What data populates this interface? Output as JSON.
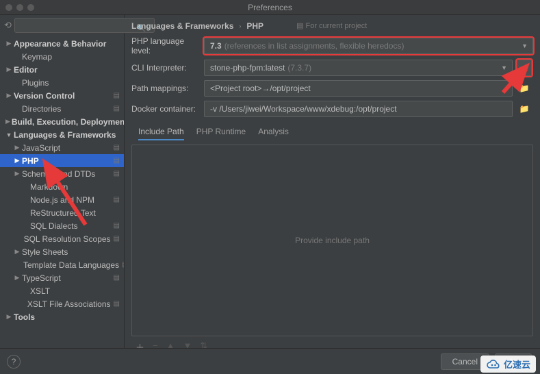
{
  "window": {
    "title": "Preferences"
  },
  "sidebar": {
    "search_placeholder": "",
    "items": [
      {
        "label": "Appearance & Behavior",
        "arrow": "▶",
        "ind": 1,
        "bold": true
      },
      {
        "label": "Keymap",
        "arrow": "",
        "ind": 2
      },
      {
        "label": "Editor",
        "arrow": "▶",
        "ind": 1,
        "bold": true
      },
      {
        "label": "Plugins",
        "arrow": "",
        "ind": 2
      },
      {
        "label": "Version Control",
        "arrow": "▶",
        "ind": 1,
        "bold": true,
        "proj": true
      },
      {
        "label": "Directories",
        "arrow": "",
        "ind": 2,
        "proj": true
      },
      {
        "label": "Build, Execution, Deployment",
        "arrow": "▶",
        "ind": 1,
        "bold": true
      },
      {
        "label": "Languages & Frameworks",
        "arrow": "▼",
        "ind": 1,
        "bold": true,
        "open": true
      },
      {
        "label": "JavaScript",
        "arrow": "▶",
        "ind": 2,
        "proj": true
      },
      {
        "label": "PHP",
        "arrow": "▶",
        "ind": 2,
        "selected": true,
        "proj": true
      },
      {
        "label": "Schemas and DTDs",
        "arrow": "▶",
        "ind": 2,
        "proj": true
      },
      {
        "label": "Markdown",
        "arrow": "",
        "ind": 3
      },
      {
        "label": "Node.js and NPM",
        "arrow": "",
        "ind": 3,
        "proj": true
      },
      {
        "label": "ReStructured Text",
        "arrow": "",
        "ind": 3
      },
      {
        "label": "SQL Dialects",
        "arrow": "",
        "ind": 3,
        "proj": true
      },
      {
        "label": "SQL Resolution Scopes",
        "arrow": "",
        "ind": 3,
        "proj": true
      },
      {
        "label": "Style Sheets",
        "arrow": "▶",
        "ind": 2
      },
      {
        "label": "Template Data Languages",
        "arrow": "",
        "ind": 3,
        "proj": true
      },
      {
        "label": "TypeScript",
        "arrow": "▶",
        "ind": 2,
        "proj": true
      },
      {
        "label": "XSLT",
        "arrow": "",
        "ind": 3
      },
      {
        "label": "XSLT File Associations",
        "arrow": "",
        "ind": 3,
        "proj": true
      },
      {
        "label": "Tools",
        "arrow": "▶",
        "ind": 1,
        "bold": true
      }
    ]
  },
  "breadcrumb": {
    "a": "Languages & Frameworks",
    "b": "PHP",
    "current_project": "For current project"
  },
  "fields": {
    "lang_level_label": "PHP language level:",
    "lang_level_value": "7.3",
    "lang_level_hint": "(references in list assignments, flexible heredocs)",
    "cli_label": "CLI Interpreter:",
    "cli_value": "stone-php-fpm:latest",
    "cli_hint": "(7.3.7)",
    "path_label": "Path mappings:",
    "path_value": "<Project root>→/opt/project",
    "docker_label": "Docker container:",
    "docker_value": "-v /Users/jiwei/Workspace/www/xdebug:/opt/project"
  },
  "tabs": {
    "a": "Include Path",
    "b": "PHP Runtime",
    "c": "Analysis"
  },
  "panel": {
    "empty": "Provide include path"
  },
  "buttons": {
    "cancel": "Cancel",
    "apply": "Ap"
  },
  "watermark": {
    "text": "亿速云"
  }
}
